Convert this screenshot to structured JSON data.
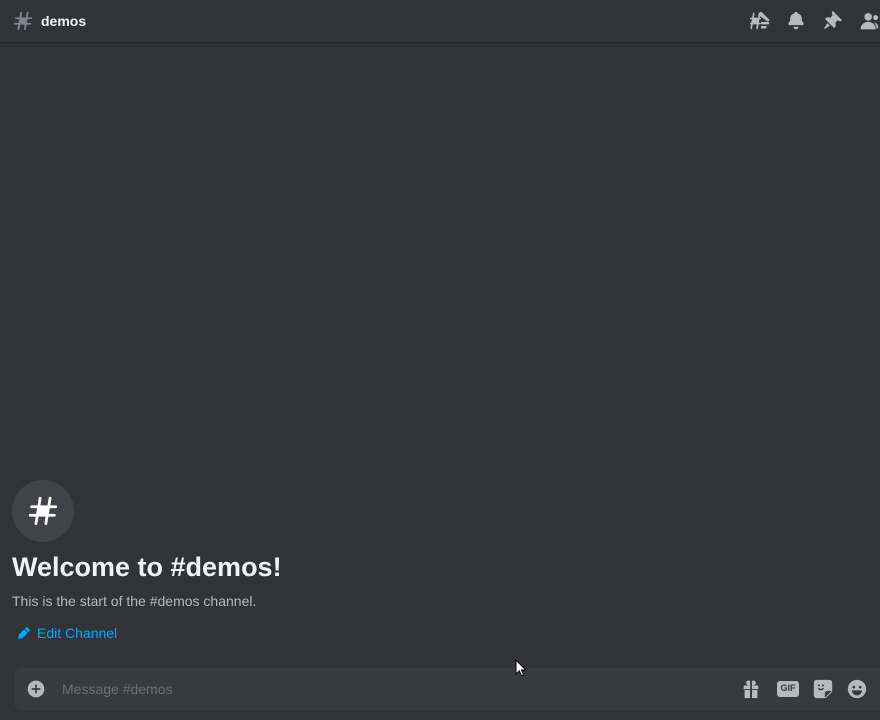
{
  "header": {
    "channel_name": "demos",
    "icons": [
      "threads-icon",
      "bell-icon",
      "pin-icon",
      "members-icon"
    ]
  },
  "welcome": {
    "title": "Welcome to #demos!",
    "subtitle": "This is the start of the #demos channel.",
    "edit_label": "Edit Channel"
  },
  "composer": {
    "placeholder": "Message #demos",
    "value": "",
    "gif_label": "GIF"
  },
  "colors": {
    "background": "#313338",
    "composer_bg": "#383a40",
    "link": "#00a8fc",
    "muted_text": "#b5bac1",
    "icon": "#b5bac1"
  }
}
